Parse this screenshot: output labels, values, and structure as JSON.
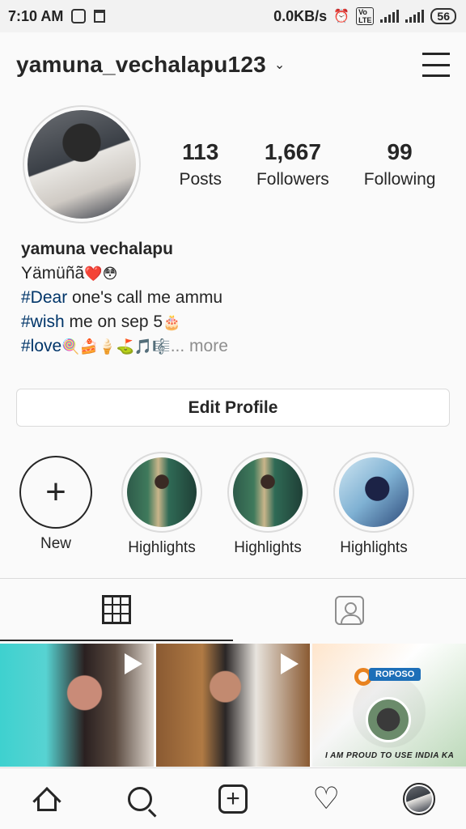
{
  "status_bar": {
    "time": "7:10 AM",
    "net_speed": "0.0KB/s",
    "battery": "56"
  },
  "header": {
    "username": "yamuna_vechalapu123"
  },
  "stats": [
    {
      "value": "113",
      "label": "Posts"
    },
    {
      "value": "1,667",
      "label": "Followers"
    },
    {
      "value": "99",
      "label": "Following"
    }
  ],
  "bio": {
    "name": "yamuna vechalapu",
    "line1": "Yämüñã",
    "line1_emoji": "❤️😳",
    "line2_tag": "#Dear",
    "line2_rest": " one's call me ammu",
    "line3_tag": "#wish",
    "line3_rest": " me on sep 5",
    "line3_emoji": "🎂",
    "line4_tag": "#love",
    "line4_emoji": "🍭🍰🍦⛳🎵🎼",
    "more": "... more"
  },
  "edit_profile_label": "Edit Profile",
  "highlights": [
    {
      "label": "New"
    },
    {
      "label": "Highlights"
    },
    {
      "label": "Highlights"
    },
    {
      "label": "Highlights"
    }
  ],
  "posts": {
    "p3_logo": "ROPOSO",
    "p3_caption": "I AM PROUD TO USE INDIA KA"
  }
}
